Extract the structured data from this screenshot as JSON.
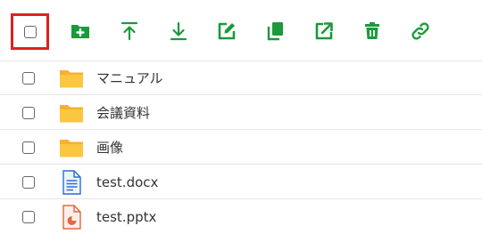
{
  "toolbar": {
    "accent_color": "#1a9a3a",
    "select_all_highlight_color": "#e02020",
    "buttons": [
      {
        "name": "new-folder-icon"
      },
      {
        "name": "upload-icon"
      },
      {
        "name": "download-icon"
      },
      {
        "name": "rename-icon"
      },
      {
        "name": "copy-icon"
      },
      {
        "name": "open-external-icon"
      },
      {
        "name": "delete-icon"
      },
      {
        "name": "link-icon"
      }
    ]
  },
  "files": [
    {
      "name": "マニュアル",
      "type": "folder",
      "icon": "folder-icon"
    },
    {
      "name": "会議資料",
      "type": "folder",
      "icon": "folder-icon"
    },
    {
      "name": "画像",
      "type": "folder",
      "icon": "folder-icon"
    },
    {
      "name": "test.docx",
      "type": "docx",
      "icon": "word-document-icon"
    },
    {
      "name": "test.pptx",
      "type": "pptx",
      "icon": "powerpoint-document-icon"
    }
  ]
}
